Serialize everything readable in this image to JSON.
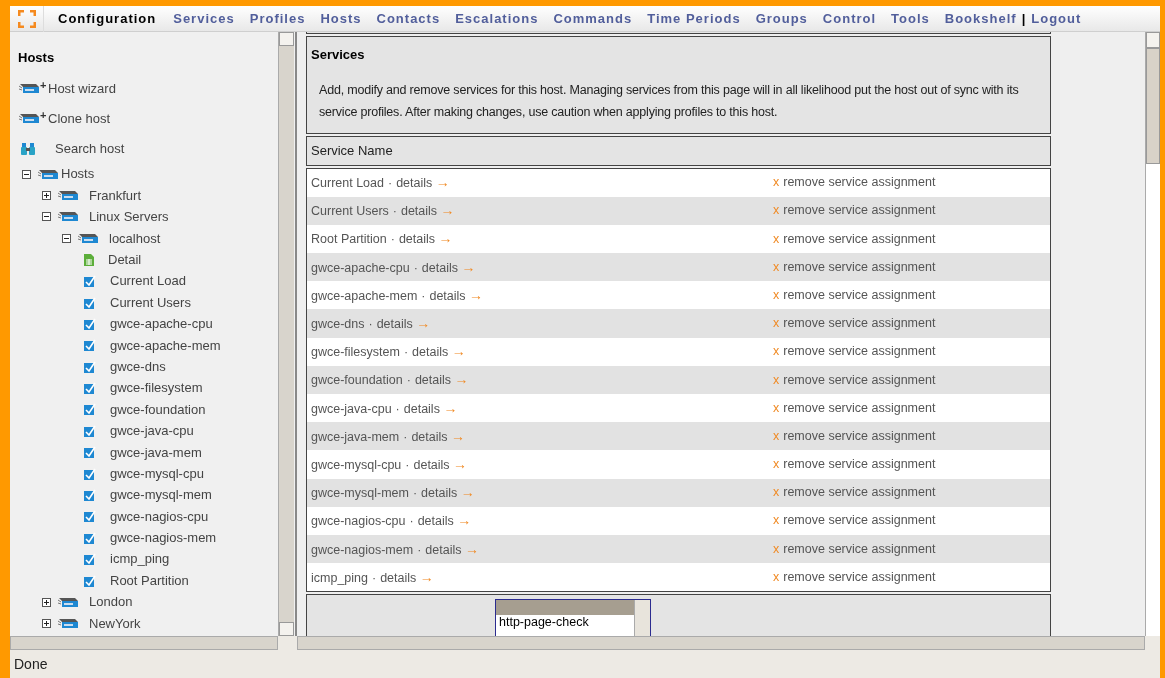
{
  "nav": {
    "items": [
      {
        "label": "Configuration",
        "selected": true
      },
      {
        "label": "Services",
        "selected": false
      },
      {
        "label": "Profiles",
        "selected": false
      },
      {
        "label": "Hosts",
        "selected": false
      },
      {
        "label": "Contacts",
        "selected": false
      },
      {
        "label": "Escalations",
        "selected": false
      },
      {
        "label": "Commands",
        "selected": false
      },
      {
        "label": "Time Periods",
        "selected": false
      },
      {
        "label": "Groups",
        "selected": false
      },
      {
        "label": "Control",
        "selected": false
      },
      {
        "label": "Tools",
        "selected": false
      },
      {
        "label": "Bookshelf",
        "selected": false
      }
    ],
    "separator": "|",
    "logout": "Logout"
  },
  "sidebar": {
    "title": "Hosts",
    "actions": [
      {
        "kind": "add",
        "badge": "+",
        "label": "Host wizard"
      },
      {
        "kind": "add",
        "badge": "+",
        "label": "Clone host"
      },
      {
        "kind": "search",
        "label": "Search host"
      }
    ],
    "tree": [
      {
        "kind": "group",
        "label": "Hosts",
        "expanded": true,
        "children": [
          {
            "kind": "group",
            "label": "Frankfurt",
            "expanded": false
          },
          {
            "kind": "group",
            "label": "Linux Servers",
            "expanded": true,
            "children": [
              {
                "kind": "group",
                "label": "localhost",
                "expanded": true,
                "children": [
                  {
                    "kind": "detail",
                    "label": "Detail"
                  },
                  {
                    "kind": "service",
                    "label": "Current Load"
                  },
                  {
                    "kind": "service",
                    "label": "Current Users"
                  },
                  {
                    "kind": "service",
                    "label": "gwce-apache-cpu"
                  },
                  {
                    "kind": "service",
                    "label": "gwce-apache-mem"
                  },
                  {
                    "kind": "service",
                    "label": "gwce-dns"
                  },
                  {
                    "kind": "service",
                    "label": "gwce-filesystem"
                  },
                  {
                    "kind": "service",
                    "label": "gwce-foundation"
                  },
                  {
                    "kind": "service",
                    "label": "gwce-java-cpu"
                  },
                  {
                    "kind": "service",
                    "label": "gwce-java-mem"
                  },
                  {
                    "kind": "service",
                    "label": "gwce-mysql-cpu"
                  },
                  {
                    "kind": "service",
                    "label": "gwce-mysql-mem"
                  },
                  {
                    "kind": "service",
                    "label": "gwce-nagios-cpu"
                  },
                  {
                    "kind": "service",
                    "label": "gwce-nagios-mem"
                  },
                  {
                    "kind": "service",
                    "label": "icmp_ping"
                  },
                  {
                    "kind": "service",
                    "label": "Root Partition"
                  }
                ]
              }
            ]
          },
          {
            "kind": "group",
            "label": "London",
            "expanded": false
          },
          {
            "kind": "group",
            "label": "NewYork",
            "expanded": false
          }
        ]
      }
    ]
  },
  "services": {
    "title": "Services",
    "description": "Add, modify and remove services for this host. Managing services from this page will in all likelihood put the host out of sync with its service profiles. After making changes, use caution when applying profiles to this host.",
    "column": "Service Name",
    "rows": [
      {
        "name": "Current Load",
        "separator": "·",
        "link": "details",
        "arrow": "→",
        "remove_icon": "x",
        "remove": "remove service assignment"
      },
      {
        "name": "Current Users",
        "separator": "·",
        "link": "details",
        "arrow": "→",
        "remove_icon": "x",
        "remove": "remove service assignment"
      },
      {
        "name": "Root Partition",
        "separator": "·",
        "link": "details",
        "arrow": "→",
        "remove_icon": "x",
        "remove": "remove service assignment"
      },
      {
        "name": "gwce-apache-cpu",
        "separator": "·",
        "link": "details",
        "arrow": "→",
        "remove_icon": "x",
        "remove": "remove service assignment"
      },
      {
        "name": "gwce-apache-mem",
        "separator": "·",
        "link": "details",
        "arrow": "→",
        "remove_icon": "x",
        "remove": "remove service assignment"
      },
      {
        "name": "gwce-dns",
        "separator": "·",
        "link": "details",
        "arrow": "→",
        "remove_icon": "x",
        "remove": "remove service assignment"
      },
      {
        "name": "gwce-filesystem",
        "separator": "·",
        "link": "details",
        "arrow": "→",
        "remove_icon": "x",
        "remove": "remove service assignment"
      },
      {
        "name": "gwce-foundation",
        "separator": "·",
        "link": "details",
        "arrow": "→",
        "remove_icon": "x",
        "remove": "remove service assignment"
      },
      {
        "name": "gwce-java-cpu",
        "separator": "·",
        "link": "details",
        "arrow": "→",
        "remove_icon": "x",
        "remove": "remove service assignment"
      },
      {
        "name": "gwce-java-mem",
        "separator": "·",
        "link": "details",
        "arrow": "→",
        "remove_icon": "x",
        "remove": "remove service assignment"
      },
      {
        "name": "gwce-mysql-cpu",
        "separator": "·",
        "link": "details",
        "arrow": "→",
        "remove_icon": "x",
        "remove": "remove service assignment"
      },
      {
        "name": "gwce-mysql-mem",
        "separator": "·",
        "link": "details",
        "arrow": "→",
        "remove_icon": "x",
        "remove": "remove service assignment"
      },
      {
        "name": "gwce-nagios-cpu",
        "separator": "·",
        "link": "details",
        "arrow": "→",
        "remove_icon": "x",
        "remove": "remove service assignment"
      },
      {
        "name": "gwce-nagios-mem",
        "separator": "·",
        "link": "details",
        "arrow": "→",
        "remove_icon": "x",
        "remove": "remove service assignment"
      },
      {
        "name": "icmp_ping",
        "separator": "·",
        "link": "details",
        "arrow": "→",
        "remove_icon": "x",
        "remove": "remove service assignment"
      }
    ],
    "add_list": {
      "options": [
        {
          "selected": true
        },
        {
          "label": "http-page-check",
          "selected": false
        }
      ]
    }
  },
  "status_bar": "Done"
}
